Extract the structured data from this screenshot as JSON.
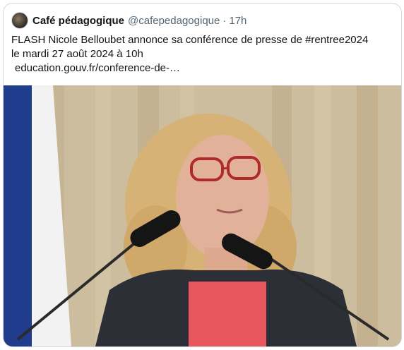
{
  "tweet": {
    "author_name": "Café pédagogique",
    "author_handle": "@cafepedagogique",
    "separator": "·",
    "timestamp": "17h",
    "text_line1": "FLASH Nicole Belloubet annonce sa conférence de presse de #rentree2024",
    "text_line2": "le mardi 27 août 2024 à 10h",
    "link_text": "education.gouv.fr/conference-de-…"
  },
  "media": {
    "description_icon": "video-still"
  },
  "colors": {
    "text": "#0f1419",
    "secondary": "#536471",
    "border": "#cfd9de"
  }
}
